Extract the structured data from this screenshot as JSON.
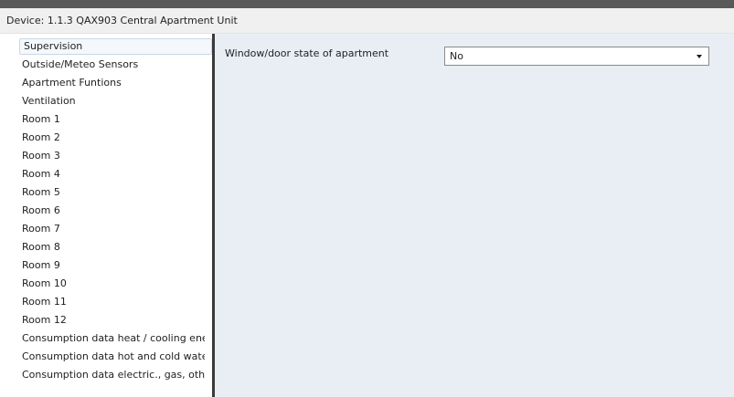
{
  "window": {
    "title": "Device: 1.1.3  QAX903 Central Apartment Unit"
  },
  "sidebar": {
    "items": [
      {
        "label": "Supervision",
        "selected": true
      },
      {
        "label": "Outside/Meteo Sensors"
      },
      {
        "label": "Apartment Funtions"
      },
      {
        "label": "Ventilation"
      },
      {
        "label": "Room 1"
      },
      {
        "label": "Room 2"
      },
      {
        "label": "Room 3"
      },
      {
        "label": "Room 4"
      },
      {
        "label": "Room 5"
      },
      {
        "label": "Room 6"
      },
      {
        "label": "Room 7"
      },
      {
        "label": "Room 8"
      },
      {
        "label": "Room 9"
      },
      {
        "label": "Room 10"
      },
      {
        "label": "Room 11"
      },
      {
        "label": "Room 12"
      },
      {
        "label": "Consumption data heat / cooling energ"
      },
      {
        "label": "Consumption data hot and cold water"
      },
      {
        "label": "Consumption data electric., gas, other"
      }
    ]
  },
  "main": {
    "parameter": {
      "label": "Window/door state of apartment",
      "value": "No",
      "icon": "chevron-down-icon"
    }
  },
  "colors": {
    "panel_background": "#e8eef4",
    "splitter": "#3a3a3a",
    "selected_item_border": "#c9d7e5"
  }
}
